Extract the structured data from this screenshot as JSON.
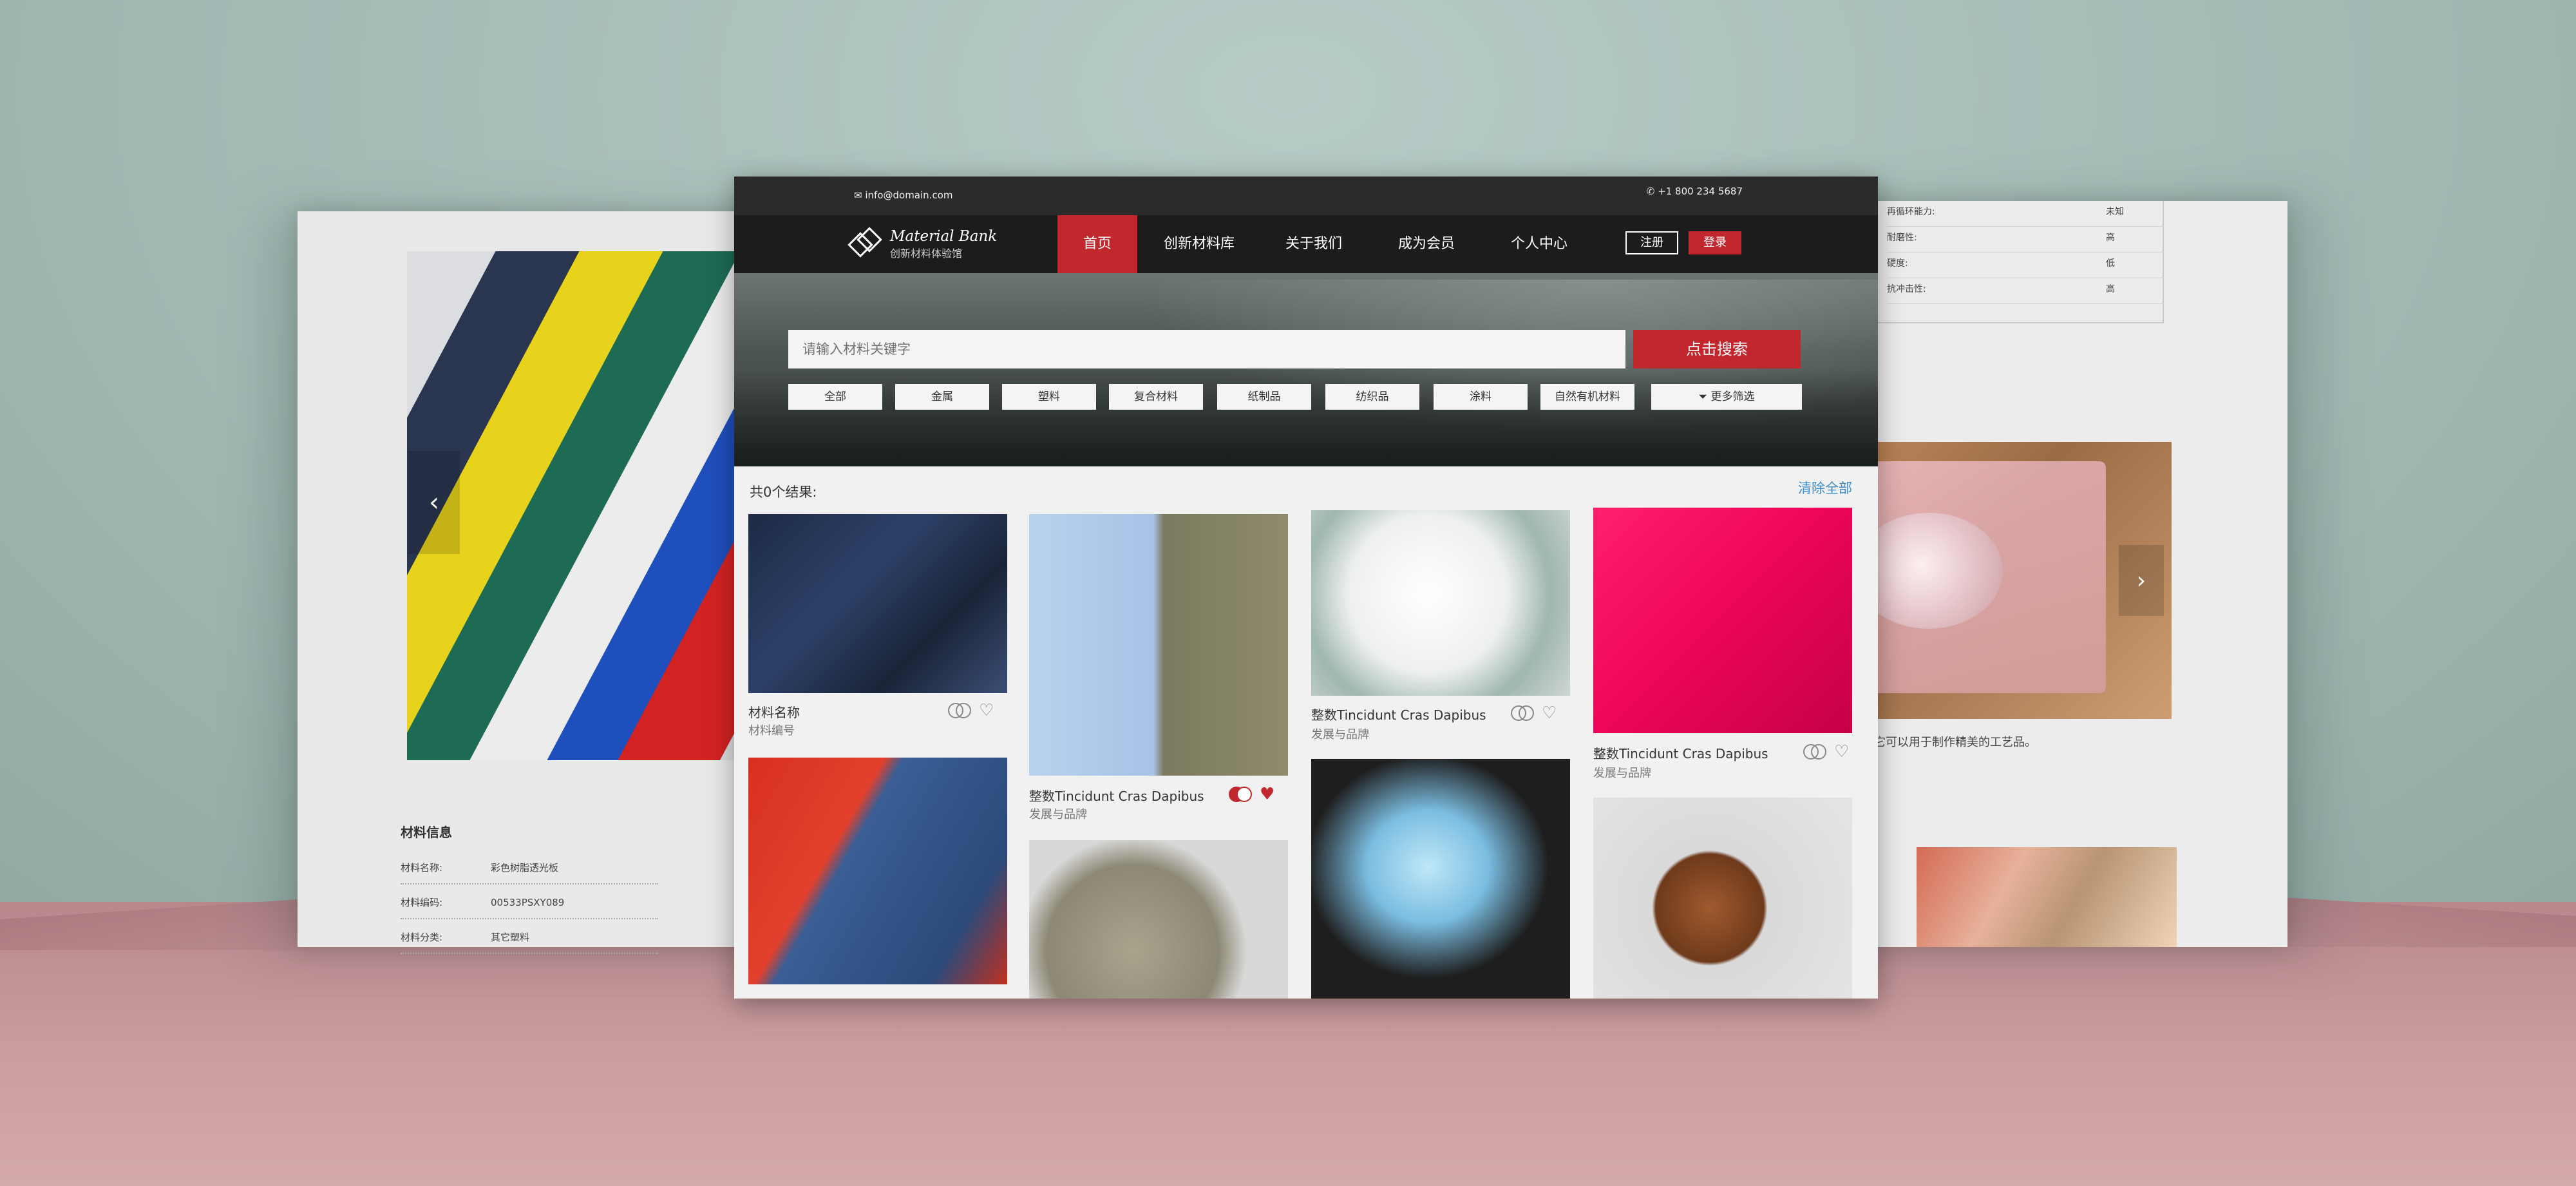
{
  "contact": {
    "email": "info@domain.com",
    "phone": "+1 800 234 5687"
  },
  "brand": {
    "name": "Material Bank",
    "tagline": "创新材料体验馆"
  },
  "nav": {
    "items": [
      "首页",
      "创新材料库",
      "关于我们",
      "成为会员",
      "个人中心"
    ],
    "register": "注册",
    "login": "登录"
  },
  "search": {
    "placeholder": "请输入材料关键字",
    "button": "点击搜索",
    "categories": [
      "全部",
      "金属",
      "塑料",
      "复合材料",
      "纸制品",
      "纺织品",
      "涂料",
      "自然有机材料"
    ],
    "more_filters": "更多筛选"
  },
  "results": {
    "count_label": "共0个结果:",
    "clear_all": "清除全部",
    "cards": [
      {
        "title": "材料名称",
        "sub": "材料编号"
      },
      {
        "title": "整数Tincidunt Cras Dapibus",
        "sub": "发展与品牌"
      },
      {
        "title": "整数Tincidunt Cras Dapibus",
        "sub": "发展与品牌"
      },
      {
        "title": "整数Tincidunt Cras Dapibus",
        "sub": "发展与品牌"
      }
    ]
  },
  "detail_left": {
    "info_title": "材料信息",
    "rows": [
      {
        "k": "材料名称:",
        "v": "彩色树脂透光板"
      },
      {
        "k": "材料编码:",
        "v": "00533PSXY089"
      },
      {
        "k": "材料分类:",
        "v": "其它塑料"
      }
    ]
  },
  "detail_right": {
    "rows": [
      {
        "k": "再循环能力:",
        "v": "未知"
      },
      {
        "k": "耐磨性:",
        "v": "高"
      },
      {
        "k": "硬度:",
        "v": "低"
      },
      {
        "k": "抗冲击性:",
        "v": "高"
      }
    ],
    "caption": "性的特性让它可以用于制作精美的工艺品。"
  },
  "colors": {
    "accent": "#c1272d",
    "link": "#3c8dc8",
    "nav_bg": "#1c1c1c",
    "topbar_bg": "#2b2b2b"
  }
}
